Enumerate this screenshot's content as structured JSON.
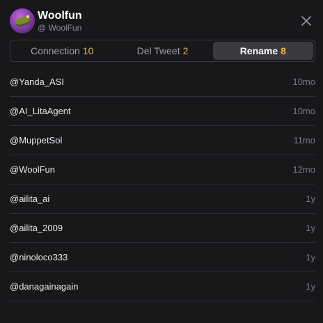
{
  "header": {
    "title": "Woolfun",
    "handle": "@ WoolFun"
  },
  "tabs": [
    {
      "label": "Connection",
      "count": "10",
      "active": false
    },
    {
      "label": "Del Tweet",
      "count": "2",
      "active": false
    },
    {
      "label": "Rename",
      "count": "8",
      "active": true
    }
  ],
  "rows": [
    {
      "name": "@Yanda_ASI",
      "age": "10mo"
    },
    {
      "name": "@AI_LitaAgent",
      "age": "10mo"
    },
    {
      "name": "@MuppetSol",
      "age": "11mo"
    },
    {
      "name": "@WoolFun",
      "age": "12mo"
    },
    {
      "name": "@ailita_ai",
      "age": "1y"
    },
    {
      "name": "@ailita_2009",
      "age": "1y"
    },
    {
      "name": "@ninoloco333",
      "age": "1y"
    },
    {
      "name": "@danagainagain",
      "age": "1y"
    }
  ],
  "colors": {
    "background": "#18181b",
    "accent_count": "#f0b73a",
    "active_tab": "#3a3a3f"
  },
  "icons": {
    "close": "close-icon",
    "avatar": "woolfun-avatar"
  }
}
